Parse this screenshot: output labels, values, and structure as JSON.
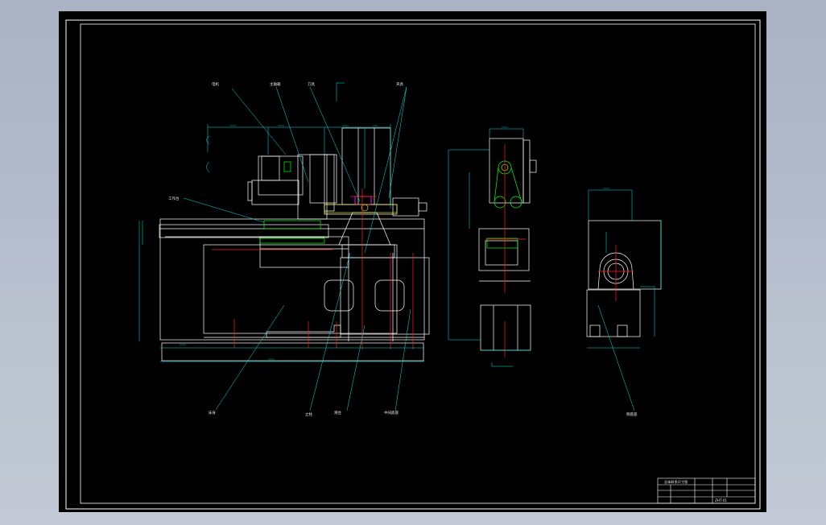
{
  "colors": {
    "outline": "#ffffff",
    "dimension": "#00e5e5",
    "center": "#ff2020",
    "part": "#00ff00",
    "highlight": "#ff00ff",
    "gear": "#ffff00",
    "leader": "#00e5e5",
    "background": "#000000"
  },
  "labels": {
    "motor": "电机",
    "spindle_box": "主轴箱",
    "tool": "刀具",
    "fixture": "夹具",
    "worktable": "工作台",
    "bed": "床身",
    "column": "立柱",
    "slide": "滑台",
    "center_bed": "中间底座",
    "side_base": "侧底座"
  },
  "title_block": {
    "drawing_title": "总体联系尺寸图",
    "drawing_number": "ZHT-01"
  }
}
